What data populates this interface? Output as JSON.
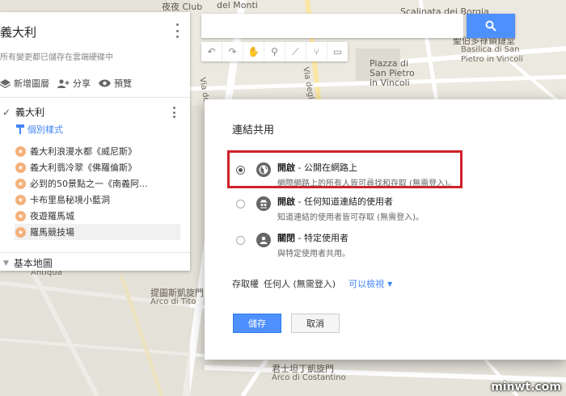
{
  "map": {
    "labels": {
      "club": "夜夜 Club",
      "monti": "del Monti",
      "borgia": "Scalinata dei Borgia",
      "vincoli_church": "聖伯多祿鎖鏈堂",
      "basilica": "Basilica di San",
      "pietro": "Pietro in Vincoli",
      "piazza1": "Piazza di",
      "piazza2": "San Pietro",
      "piazza3": "in Vincoli",
      "via_fori": "Via dei Fori",
      "via_annibaldi": "Via degli Annibaldi",
      "arco_tito_zh": "提圖斯凱旋門",
      "arco_tito": "Arco di Tito",
      "arco_constantino_zh": "君士坦丁凱旋門",
      "arco_constantino": "Arco di Costantino",
      "antiqua": "Antiqua"
    },
    "watermark": "minwt.com"
  },
  "search": {
    "icon": "search-icon",
    "button_color": "#4d90fe"
  },
  "toolbar": [
    "undo-icon",
    "redo-icon",
    "hand-icon",
    "marker-icon",
    "line-icon",
    "directions-icon",
    "ruler-icon"
  ],
  "panel": {
    "title": "義大利",
    "subtitle": "所有變更都已儲存在雲端硬碟中",
    "actions": {
      "add_layer": "新增圖層",
      "share": "分享",
      "preview": "預覽"
    },
    "layer": {
      "name": "義大利",
      "style_label": "個別樣式",
      "places": [
        "義大利浪漫水都《威尼斯》",
        "義大利翡冷翠《佛羅倫斯》",
        "必到的50景點之一《南義阿...",
        "卡布里島秘境小藍洞",
        "夜遊羅馬城",
        "羅馬競技場"
      ]
    },
    "basemap": "基本地圖"
  },
  "dialog": {
    "title": "連結共用",
    "options": [
      {
        "title_bold": "開啟",
        "title_rest": " - 公開在網路上",
        "desc": "網際網路上的所有人皆可尋找和存取 (無需登入)。",
        "selected": true
      },
      {
        "title_bold": "開啟",
        "title_rest": " - 任何知道連結的使用者",
        "desc": "知道連結的使用者皆可存取 (無需登入)。",
        "selected": false
      },
      {
        "title_bold": "關閉",
        "title_rest": " - 特定使用者",
        "desc": "與特定使用者共用。",
        "selected": false
      }
    ],
    "access_label": "存取權",
    "access_value": "任何人 (無需登入)",
    "access_link": "可以檢視",
    "save": "儲存",
    "cancel": "取消",
    "highlight_color": "#d0202a"
  }
}
